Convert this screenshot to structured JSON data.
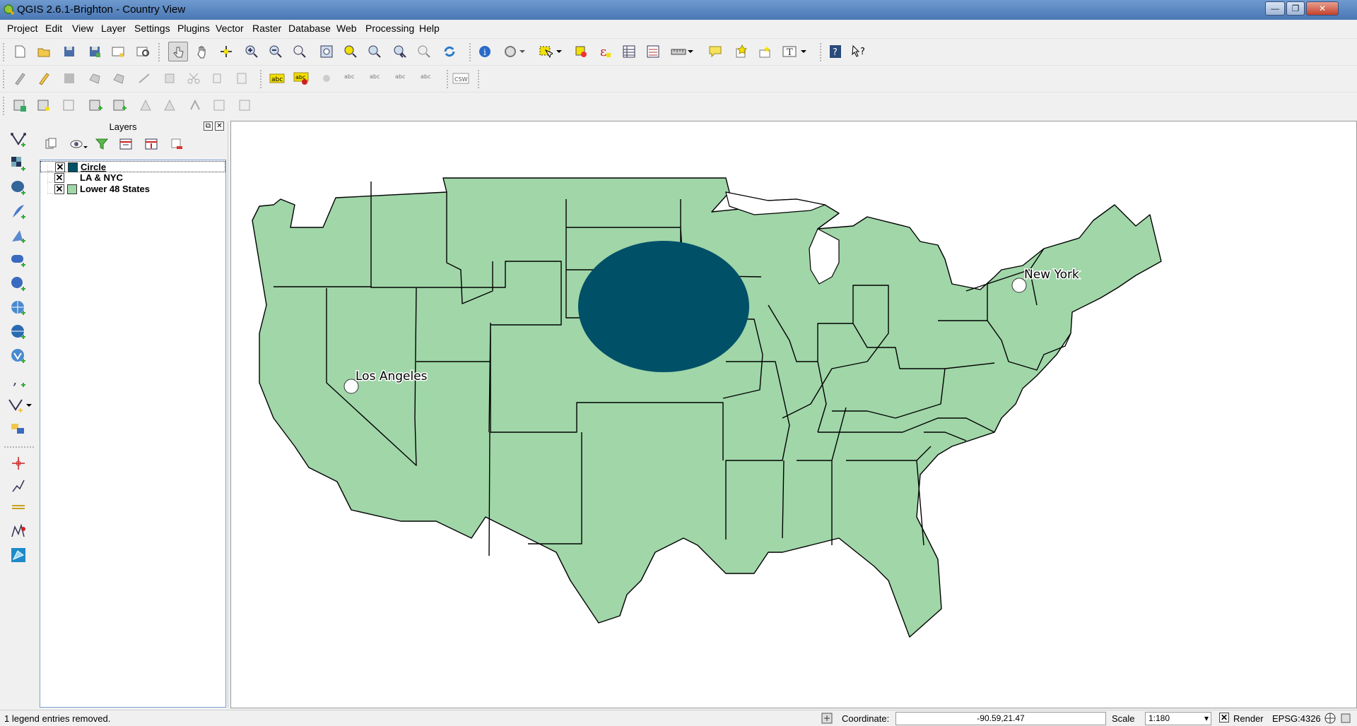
{
  "window": {
    "title": "QGIS 2.6.1-Brighton - Country View",
    "minimize": "—",
    "maximize": "❐",
    "close": "✕"
  },
  "menu": [
    "Project",
    "Edit",
    "View",
    "Layer",
    "Settings",
    "Plugins",
    "Vector",
    "Raster",
    "Database",
    "Web",
    "Processing",
    "Help"
  ],
  "layers_panel": {
    "title": "Layers",
    "layers": [
      {
        "name": "Circle",
        "checked": true,
        "color": "#005068",
        "selected": true
      },
      {
        "name": "LA & NYC",
        "checked": true,
        "color": "",
        "selected": false
      },
      {
        "name": "Lower 48 States",
        "checked": true,
        "color": "#a0d6a8",
        "selected": false
      }
    ]
  },
  "map": {
    "state_fill": "#a0d6a8",
    "circle_fill": "#005068",
    "labels": {
      "los_angeles": "Los Angeles",
      "new_york": "New York"
    }
  },
  "status": {
    "message": "1 legend entries removed.",
    "coordinate_label": "Coordinate:",
    "coordinate_value": "-90.59,21.47",
    "scale_label": "Scale",
    "scale_value": "1:180",
    "render_label": "Render",
    "crs": "EPSG:4326"
  },
  "toolbar": {
    "csw": "CSW"
  }
}
